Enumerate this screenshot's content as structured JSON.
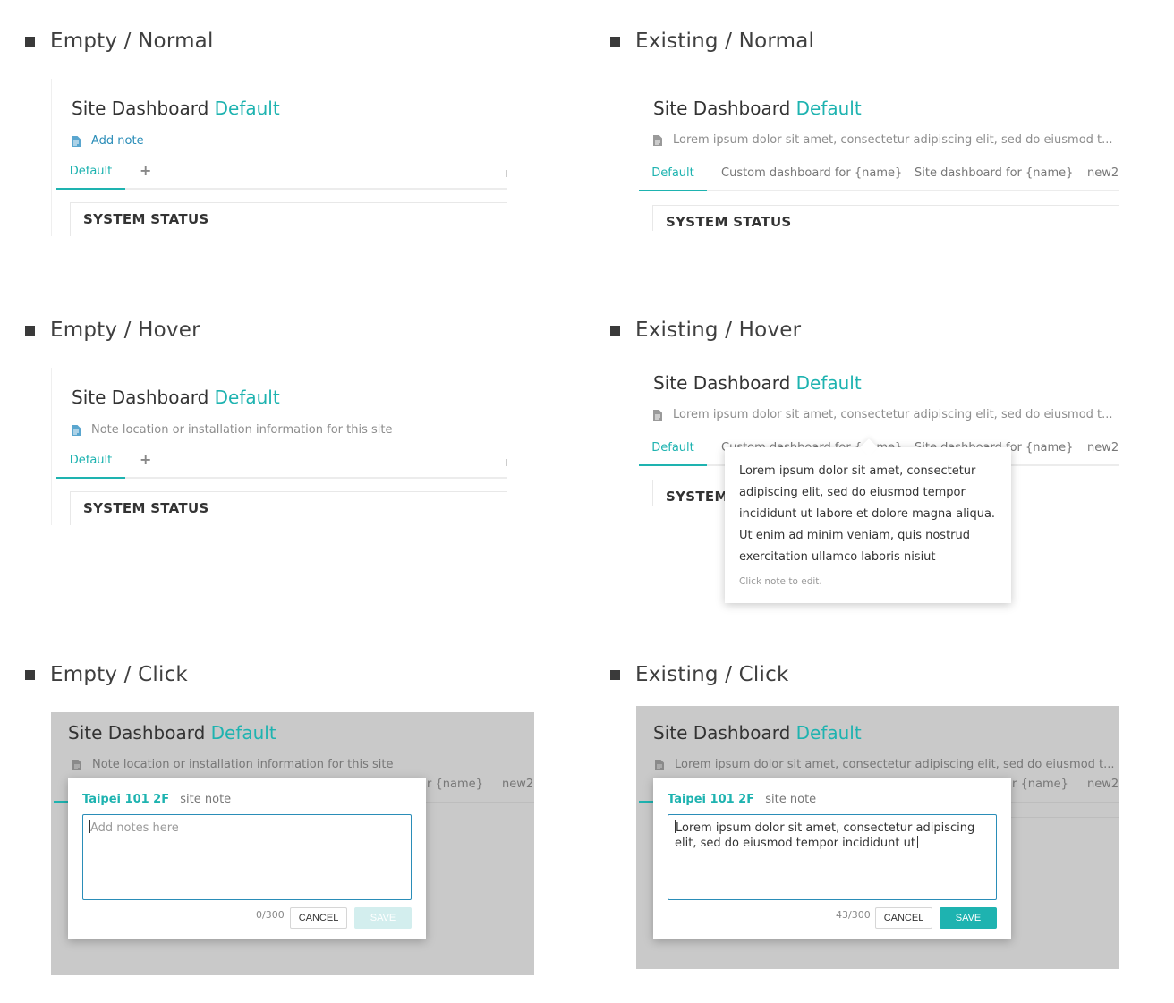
{
  "sections": {
    "empty_normal": "Empty / Normal",
    "existing_normal": "Existing / Normal",
    "empty_hover": "Empty / Hover",
    "existing_hover": "Existing / Hover",
    "empty_click": "Empty / Click",
    "existing_click": "Existing / Click"
  },
  "dashboard": {
    "title": "Site Dashboard",
    "title_accent": "Default",
    "status_title": "SYSTEM STATUS",
    "status_title_clipped": "SYSTEM S"
  },
  "notes": {
    "add_link": "Add note",
    "placeholder_hint": "Note location or installation information for this site",
    "existing_truncated": "Lorem ipsum dolor sit amet, consectetur adipiscing elit, sed do eiusmod t..."
  },
  "tabs": {
    "default": "Default",
    "add": "+",
    "custom": "Custom dashboard for {name}",
    "site": "Site dashboard for {name}",
    "new2": "new2",
    "name_fragment": "r {name}"
  },
  "tooltip": {
    "body": "Lorem ipsum dolor sit amet, consectetur adipiscing elit, sed do eiusmod tempor incididunt ut labore et dolore magna aliqua. Ut enim ad minim veniam, quis nostrud exercitation ullamco laboris nisiut",
    "hint": "Click note to edit."
  },
  "dialog": {
    "site_name": "Taipei 101 2F",
    "subtitle": "site note",
    "placeholder": "Add notes here",
    "existing_value": "Lorem ipsum dolor sit amet, consectetur adipiscing elit, sed do eiusmod tempor incididunt ut",
    "count_empty": "0/300",
    "count_existing": "43/300",
    "cancel": "CANCEL",
    "save": "SAVE"
  },
  "icons": {
    "bullet": "square-bullet-icon",
    "note": "document-icon",
    "add_tab": "plus-icon"
  },
  "colors": {
    "accent": "#1eb3b0",
    "link": "#2a8db8",
    "overlay": "#c9c9c9",
    "save_disabled": "#d3eeee"
  }
}
